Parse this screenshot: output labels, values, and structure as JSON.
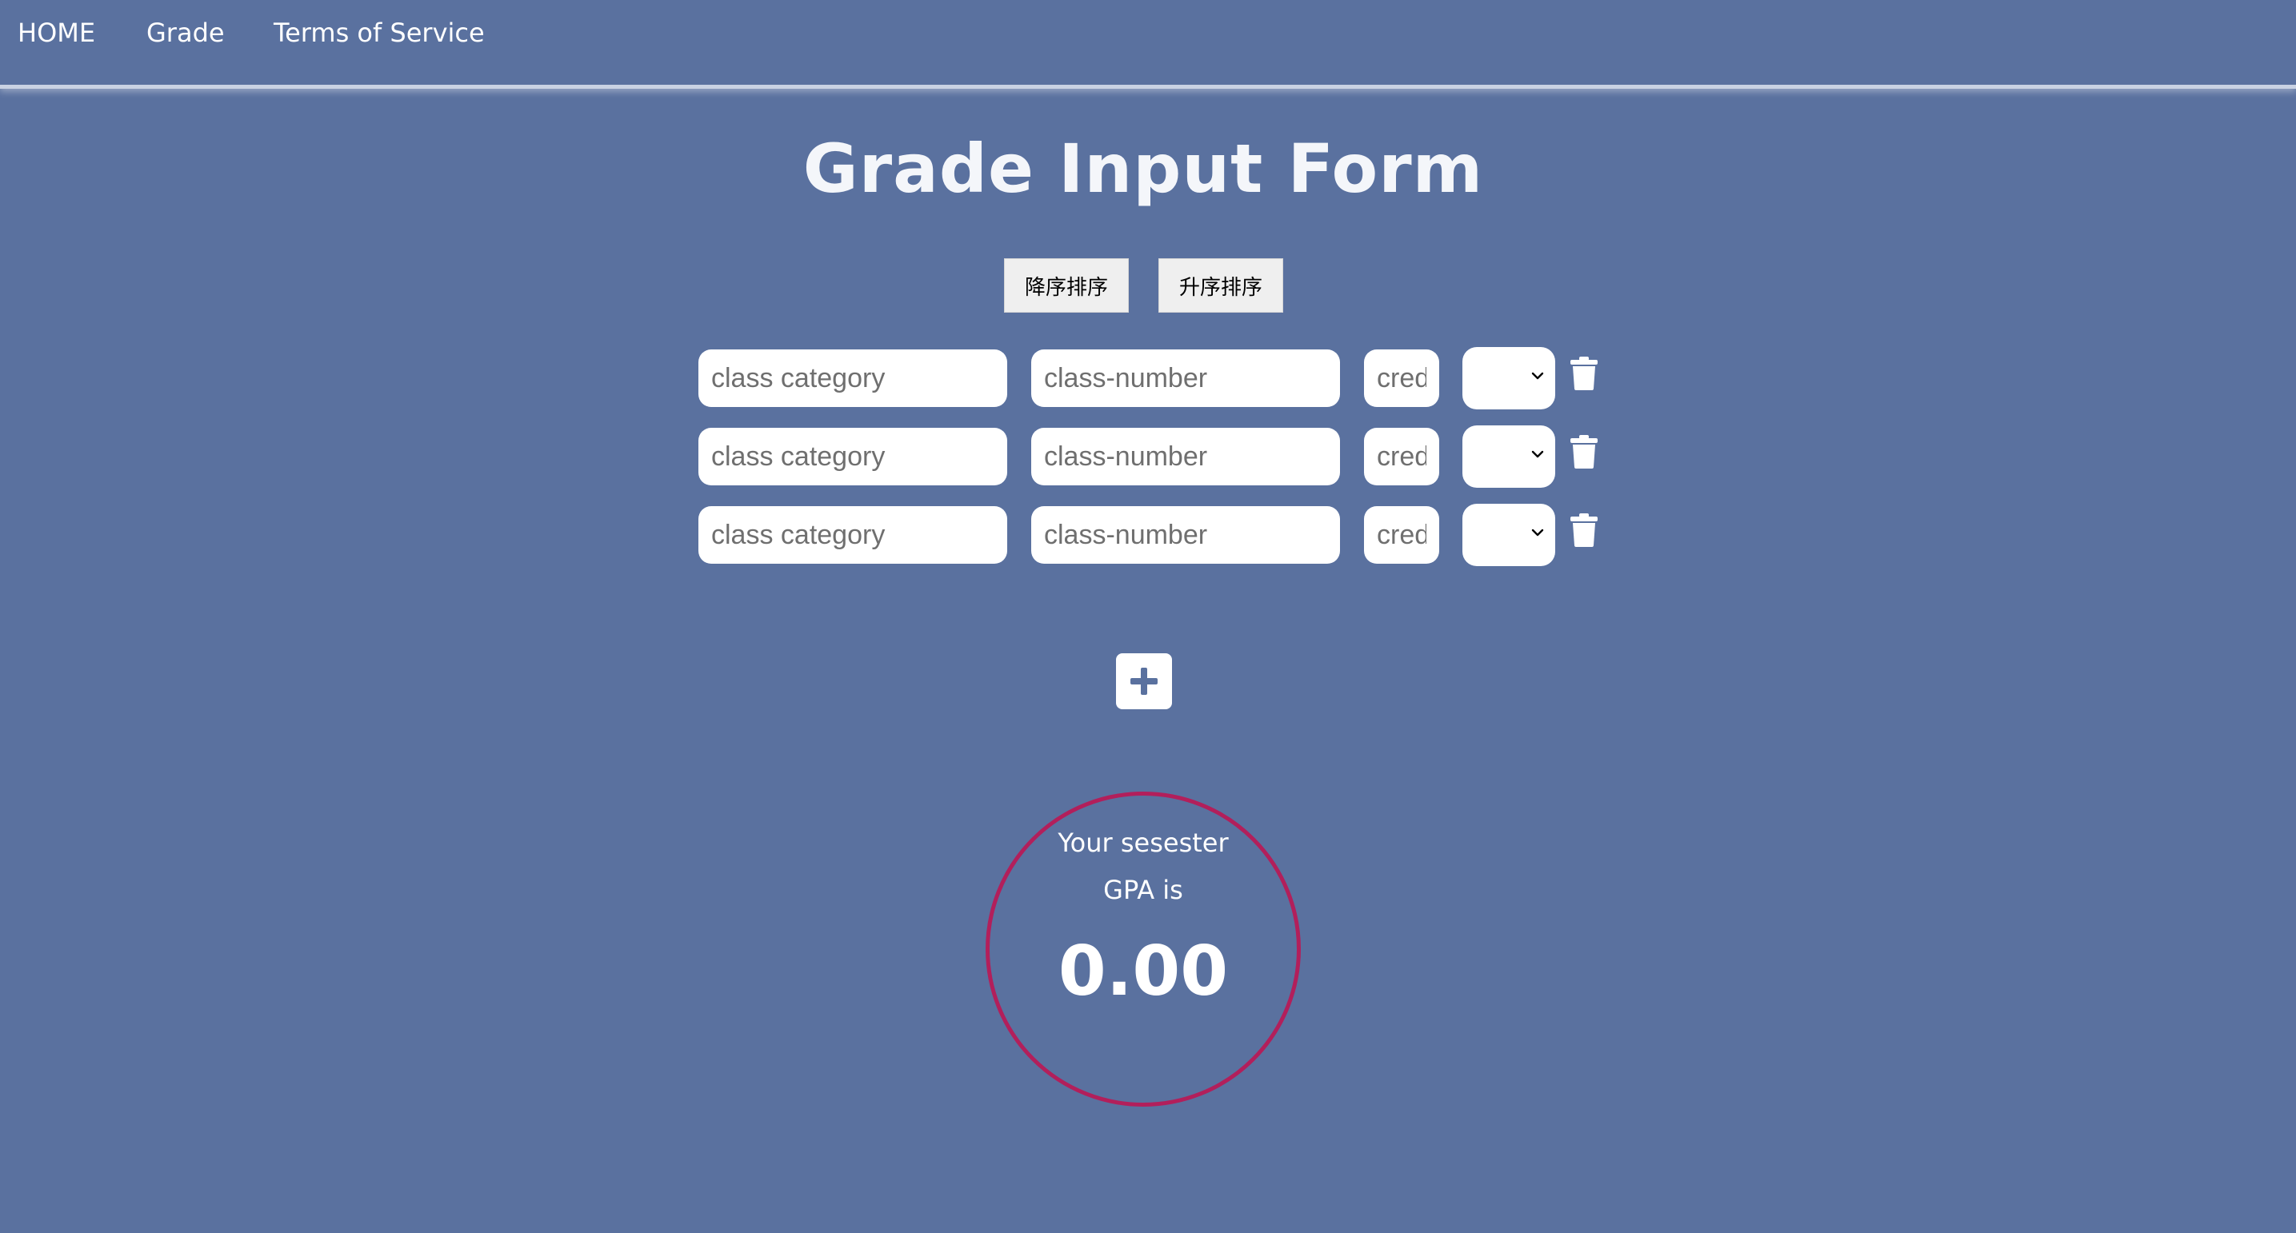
{
  "nav": {
    "home": "HOME",
    "grade": "Grade",
    "terms": "Terms of Service"
  },
  "title": "Grade Input Form",
  "sort": {
    "descending": "降序排序",
    "ascending": "升序排序"
  },
  "rows": [
    {
      "category_placeholder": "class category",
      "number_placeholder": "class-number",
      "credit_placeholder": "credit",
      "grade_value": ""
    },
    {
      "category_placeholder": "class category",
      "number_placeholder": "class-number",
      "credit_placeholder": "credit",
      "grade_value": ""
    },
    {
      "category_placeholder": "class category",
      "number_placeholder": "class-number",
      "credit_placeholder": "credit",
      "grade_value": ""
    }
  ],
  "gpa": {
    "line1": "Your sesester",
    "line2": "GPA is",
    "value": "0.00"
  },
  "colors": {
    "background": "#5a719f",
    "circle_border": "#b21f5b",
    "icon": "#ffffff"
  },
  "icons": {
    "delete": "trash-icon",
    "add": "plus-icon",
    "select": "chevron-down-icon"
  }
}
